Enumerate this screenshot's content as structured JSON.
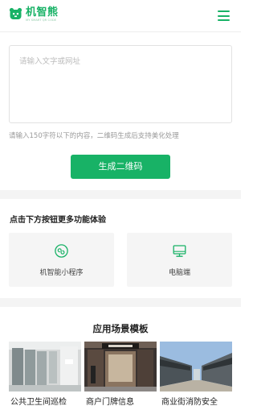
{
  "header": {
    "logo_name": "机智熊",
    "logo_subtitle": "MY SMART QR CODE",
    "logo_icon": "bear-icon",
    "menu_icon": "hamburger-menu-icon"
  },
  "generator": {
    "input_placeholder": "请输入文字或网址",
    "input_value": "",
    "hint": "请输入150字符以下的内容，二维码生成后支持美化处理",
    "generate_label": "生成二维码"
  },
  "features": {
    "title": "点击下方按钮更多功能体验",
    "items": [
      {
        "label": "机智能小程序",
        "icon": "mini-program-icon"
      },
      {
        "label": "电脑端",
        "icon": "desktop-monitor-icon"
      }
    ]
  },
  "templates": {
    "title": "应用场景模板",
    "items": [
      {
        "label": "公共卫生间巡检",
        "image": "restroom-photo"
      },
      {
        "label": "商户门牌信息",
        "image": "shop-front-photo"
      },
      {
        "label": "商业街消防安全",
        "image": "commercial-street-photo"
      }
    ]
  },
  "colors": {
    "accent": "#18b266",
    "background_band": "#f4f4f4",
    "feature_card": "#f5f5f5"
  }
}
